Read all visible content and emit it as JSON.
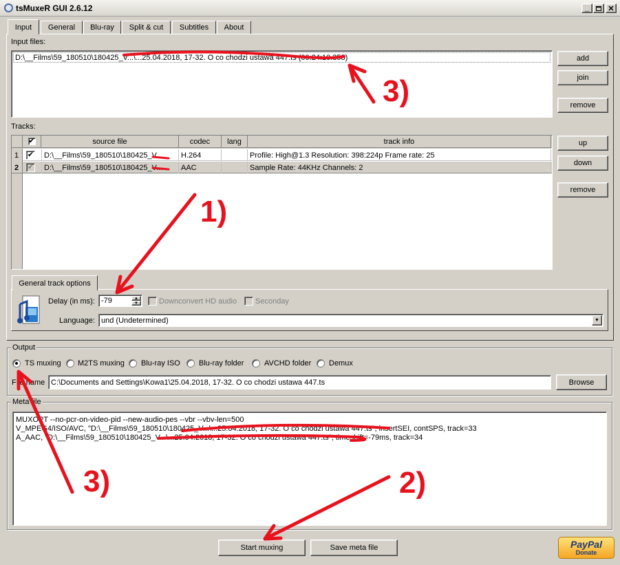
{
  "window": {
    "title": "tsMuxeR GUI 2.6.12"
  },
  "tabs": [
    "Input",
    "General",
    "Blu-ray",
    "Split & cut",
    "Subtitles",
    "About"
  ],
  "input": {
    "input_files_label": "Input files:",
    "files": [
      "D:\\__Films\\59_180510\\180425_V...\\...25.04.2018, 17-32. O co chodzi ustawa 447.ts (00:24:10.358)"
    ],
    "buttons": {
      "add": "add",
      "join": "join",
      "remove": "remove"
    }
  },
  "tracks": {
    "label": "Tracks:",
    "columns": [
      "source file",
      "codec",
      "lang",
      "track info"
    ],
    "rows": [
      {
        "num": "1",
        "source": "D:\\__Films\\59_180510\\180425_V...",
        "codec": "H.264",
        "lang": "",
        "info": "Profile: High@1.3  Resolution: 398:224p  Frame rate: 25"
      },
      {
        "num": "2",
        "source": "D:\\__Films\\59_180510\\180425_V...",
        "codec": "AAC",
        "lang": "",
        "info": "Sample Rate: 44KHz  Channels: 2"
      }
    ],
    "buttons": {
      "up": "up",
      "down": "down",
      "remove": "remove"
    }
  },
  "track_options": {
    "tab": "General track options",
    "delay_label": "Delay (in ms):",
    "delay_value": "-79",
    "downconvert_label": "Downconvert HD audio",
    "secondary_label": "Seconday",
    "language_label": "Language:",
    "language_value": "und (Undetermined)"
  },
  "output": {
    "group_label": "Output",
    "options": [
      "TS muxing",
      "M2TS muxing",
      "Blu-ray ISO",
      "Blu-ray folder",
      "AVCHD folder",
      "Demux"
    ],
    "selected": "TS muxing",
    "filename_label": "File name",
    "filename_value": "C:\\Documents and Settings\\Kowa1\\25.04.2018, 17-32. O co chodzi ustawa 447.ts",
    "browse_label": "Browse"
  },
  "meta": {
    "group_label": "Meta file",
    "lines": [
      "MUXOPT --no-pcr-on-video-pid --new-audio-pes --vbr  --vbv-len=500",
      "V_MPEG4/ISO/AVC, \"D:\\__Films\\59_180510\\180425_V...\\...25.04.2018, 17-32. O co chodzi ustawa 447.ts\", insertSEI, contSPS, track=33",
      "A_AAC, \"D:\\__Films\\59_180510\\180425_V...\\...25.04.2018, 17-32. O co chodzi ustawa 447.ts\", timeshift=-79ms, track=34"
    ]
  },
  "bottom": {
    "start": "Start muxing",
    "save": "Save meta file",
    "paypal_top": "PayPal",
    "paypal_bottom": "Donate"
  },
  "annotations": {
    "a1": "1)",
    "a2": "2)",
    "a3a": "3)",
    "a3b": "3)"
  },
  "colors": {
    "annotation_red": "#e8121e",
    "window_bg": "#d4d0c8"
  }
}
